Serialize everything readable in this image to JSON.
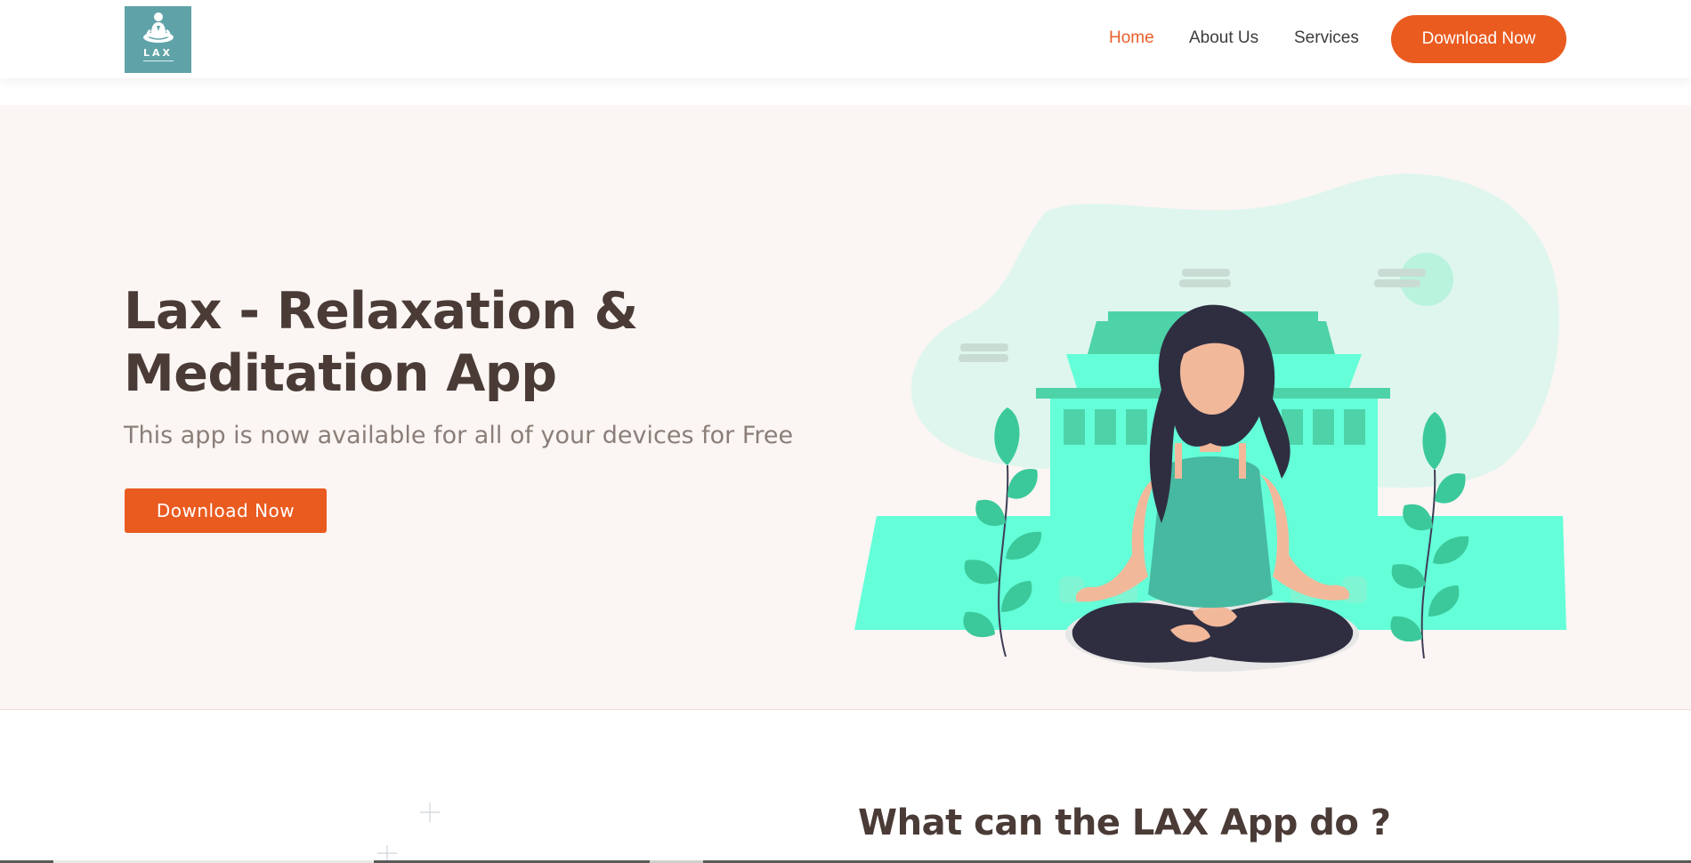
{
  "brand": {
    "logo_text": "LAX",
    "logo_color": "#5fa3a8"
  },
  "nav": {
    "items": [
      {
        "label": "Home",
        "active": true
      },
      {
        "label": "About Us",
        "active": false
      },
      {
        "label": "Services",
        "active": false
      }
    ],
    "cta_label": "Download Now"
  },
  "hero": {
    "title": "Lax - Relaxation & Meditation App",
    "subtitle": "This app is now available for all of your devices for Free",
    "button_label": "Download Now"
  },
  "features": {
    "title": "What can the LAX App do ?"
  },
  "colors": {
    "accent": "#ea5b20",
    "hero_bg": "#fbf6f3",
    "heading": "#4a3b36",
    "mint": "#64ffd8",
    "teal": "#47b9a0"
  }
}
